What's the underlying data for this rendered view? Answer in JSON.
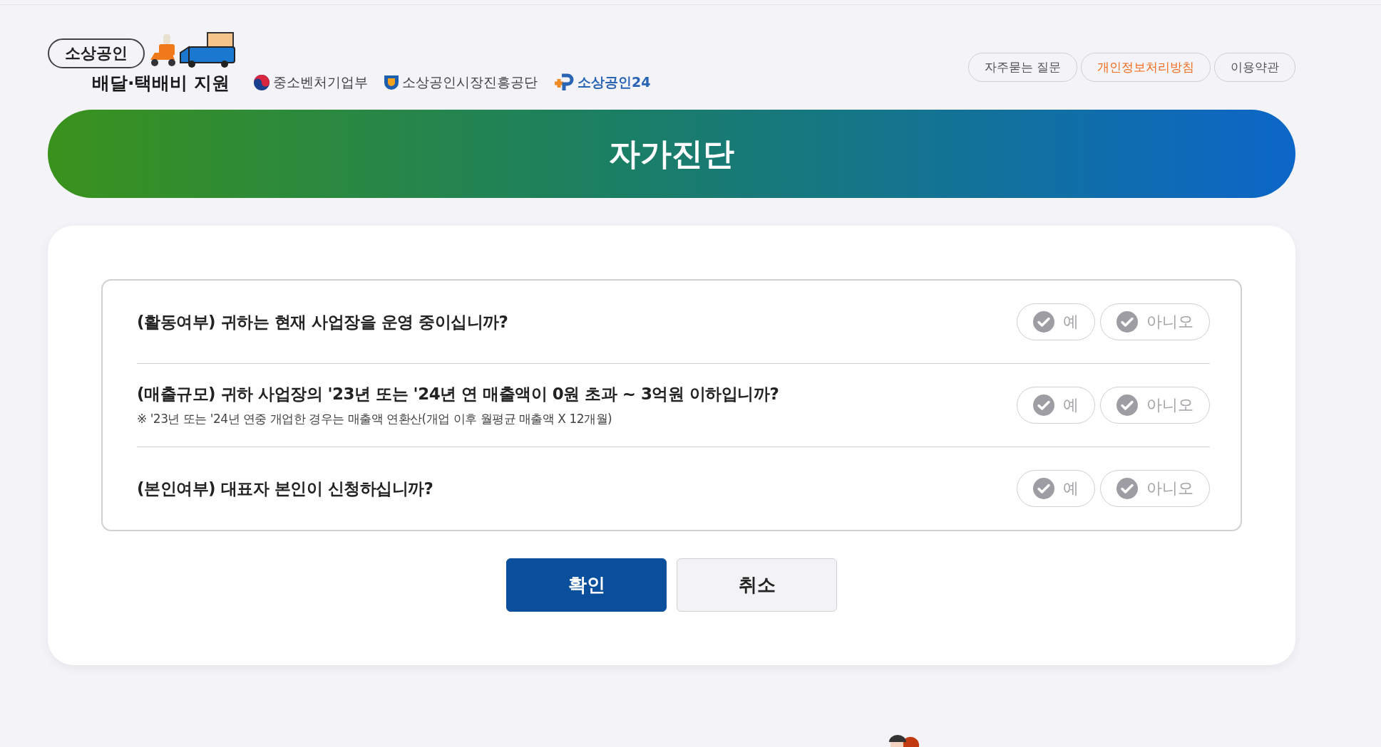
{
  "header": {
    "logo": {
      "top": "소상공인",
      "bottom": "배달·택배비 지원"
    },
    "partners": [
      {
        "kind": "ministry",
        "label": "중소벤처기업부"
      },
      {
        "kind": "agency",
        "label": "소상공인시장진흥공단"
      },
      {
        "kind": "portal",
        "label": "소상공인24"
      }
    ],
    "links": [
      {
        "label": "자주묻는 질문",
        "selected": false
      },
      {
        "label": "개인정보처리방침",
        "selected": true
      },
      {
        "label": "이용약관",
        "selected": false
      }
    ]
  },
  "banner": {
    "title": "자가진단"
  },
  "questions": [
    {
      "text": "(활동여부) 귀하는 현재 사업장을 운영 중이십니까?",
      "options": [
        {
          "label": "예",
          "selected": false
        },
        {
          "label": "아니오",
          "selected": false
        }
      ]
    },
    {
      "text": "(매출규모) 귀하 사업장의 '23년 또는 '24년 연 매출액이 0원 초과 ~ 3억원 이하입니까?",
      "note": "※ '23년 또는 '24년 연중 개업한 경우는 매출액 연환산(개업 이후 월평균 매출액 X 12개월)",
      "options": [
        {
          "label": "예",
          "selected": false
        },
        {
          "label": "아니오",
          "selected": false
        }
      ]
    },
    {
      "text": "(본인여부) 대표자 본인이 신청하십니까?",
      "options": [
        {
          "label": "예",
          "selected": false
        },
        {
          "label": "아니오",
          "selected": false
        }
      ]
    }
  ],
  "actions": [
    {
      "kind": "primary",
      "label": "확인"
    },
    {
      "kind": "secondary",
      "label": "취소"
    }
  ]
}
